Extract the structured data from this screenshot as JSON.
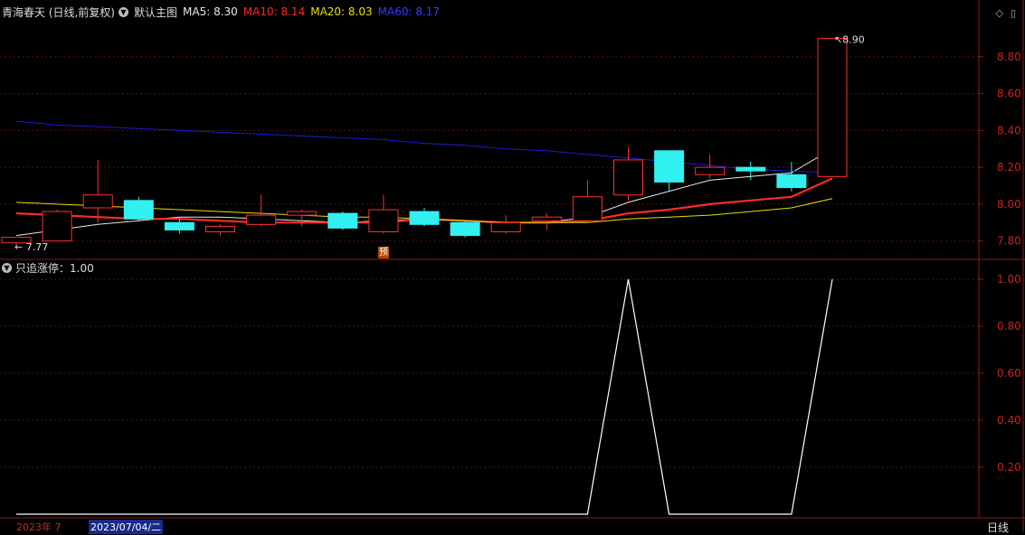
{
  "header": {
    "stock_title": "青海春天 (日线,前复权)",
    "main_chart_label": "默认主图",
    "ma": [
      {
        "label": "MA5: 8.30",
        "color": "#e8e8e8"
      },
      {
        "label": "MA10: 8.14",
        "color": "#ff2a2a"
      },
      {
        "label": "MA20: 8.03",
        "color": "#e8e000"
      },
      {
        "label": "MA60: 8.17",
        "color": "#3a3aff"
      }
    ]
  },
  "indicator_header": {
    "label": "只追涨停：1.00"
  },
  "footer": {
    "date_left": "2023年 7",
    "date_selected": "2023/07/04/二",
    "period": "日线"
  },
  "markers": {
    "yu": "预",
    "min_label": "7.77",
    "max_label": "8.90"
  },
  "chart_data": [
    {
      "type": "candlestick",
      "title": "",
      "ylim": [
        7.72,
        9.0
      ],
      "yticks": [
        "7.80",
        "8.00",
        "8.20",
        "8.40",
        "8.60",
        "8.80"
      ],
      "grid": true,
      "candles": [
        {
          "o": 7.79,
          "h": 7.82,
          "l": 7.77,
          "c": 7.82
        },
        {
          "o": 7.8,
          "h": 7.97,
          "l": 7.8,
          "c": 7.96
        },
        {
          "o": 7.98,
          "h": 8.24,
          "l": 7.9,
          "c": 8.05
        },
        {
          "o": 8.02,
          "h": 8.04,
          "l": 7.91,
          "c": 7.92
        },
        {
          "o": 7.9,
          "h": 7.92,
          "l": 7.84,
          "c": 7.86
        },
        {
          "o": 7.85,
          "h": 7.89,
          "l": 7.83,
          "c": 7.88
        },
        {
          "o": 7.89,
          "h": 8.05,
          "l": 7.88,
          "c": 7.94
        },
        {
          "o": 7.94,
          "h": 7.97,
          "l": 7.88,
          "c": 7.96
        },
        {
          "o": 7.95,
          "h": 7.96,
          "l": 7.86,
          "c": 7.87
        },
        {
          "o": 7.85,
          "h": 8.05,
          "l": 7.84,
          "c": 7.97
        },
        {
          "o": 7.96,
          "h": 7.98,
          "l": 7.88,
          "c": 7.89
        },
        {
          "o": 7.9,
          "h": 7.91,
          "l": 7.82,
          "c": 7.83
        },
        {
          "o": 7.85,
          "h": 7.94,
          "l": 7.84,
          "c": 7.9
        },
        {
          "o": 7.91,
          "h": 7.95,
          "l": 7.86,
          "c": 7.93
        },
        {
          "o": 7.91,
          "h": 8.13,
          "l": 7.9,
          "c": 8.04
        },
        {
          "o": 8.05,
          "h": 8.31,
          "l": 8.02,
          "c": 8.24
        },
        {
          "o": 8.29,
          "h": 8.29,
          "l": 8.07,
          "c": 8.12
        },
        {
          "o": 8.16,
          "h": 8.27,
          "l": 8.14,
          "c": 8.2
        },
        {
          "o": 8.2,
          "h": 8.23,
          "l": 8.13,
          "c": 8.18
        },
        {
          "o": 8.16,
          "h": 8.23,
          "l": 8.07,
          "c": 8.09
        },
        {
          "o": 8.15,
          "h": 8.9,
          "l": 8.15,
          "c": 8.9
        }
      ],
      "series": [
        {
          "name": "MA5",
          "color": "#e8e8e8",
          "width": 1,
          "values": [
            7.83,
            7.86,
            7.89,
            7.91,
            7.93,
            7.93,
            7.92,
            7.91,
            7.9,
            7.91,
            7.92,
            7.91,
            7.9,
            7.9,
            7.93,
            8.01,
            8.07,
            8.13,
            8.15,
            8.17,
            8.3
          ]
        },
        {
          "name": "MA10",
          "color": "#ff2a2a",
          "width": 2.2,
          "values": [
            7.95,
            7.94,
            7.93,
            7.92,
            7.92,
            7.91,
            7.9,
            7.9,
            7.9,
            7.9,
            7.92,
            7.91,
            7.9,
            7.9,
            7.91,
            7.95,
            7.97,
            8.0,
            8.02,
            8.04,
            8.14
          ]
        },
        {
          "name": "MA20",
          "color": "#e8e000",
          "width": 1,
          "values": [
            8.01,
            8.0,
            7.99,
            7.98,
            7.97,
            7.96,
            7.95,
            7.94,
            7.93,
            7.93,
            7.92,
            7.91,
            7.9,
            7.9,
            7.9,
            7.92,
            7.93,
            7.94,
            7.96,
            7.98,
            8.03
          ]
        },
        {
          "name": "MA60",
          "color": "#1c1cd8",
          "width": 1,
          "values": [
            8.45,
            8.43,
            8.42,
            8.41,
            8.4,
            8.39,
            8.38,
            8.37,
            8.36,
            8.35,
            8.33,
            8.32,
            8.3,
            8.29,
            8.27,
            8.25,
            8.23,
            8.21,
            8.19,
            8.18,
            8.17
          ]
        }
      ]
    },
    {
      "type": "line",
      "title": "",
      "ylim": [
        0,
        1.05
      ],
      "yticks": [
        "0.20",
        "0.40",
        "0.60",
        "0.80",
        "1.00"
      ],
      "grid": true,
      "series": [
        {
          "name": "只追涨停",
          "color": "#ffffff",
          "values": [
            0,
            0,
            0,
            0,
            0,
            0,
            0,
            0,
            0,
            0,
            0,
            0,
            0,
            0,
            0,
            1,
            0,
            0,
            0,
            0,
            1
          ]
        }
      ]
    }
  ]
}
